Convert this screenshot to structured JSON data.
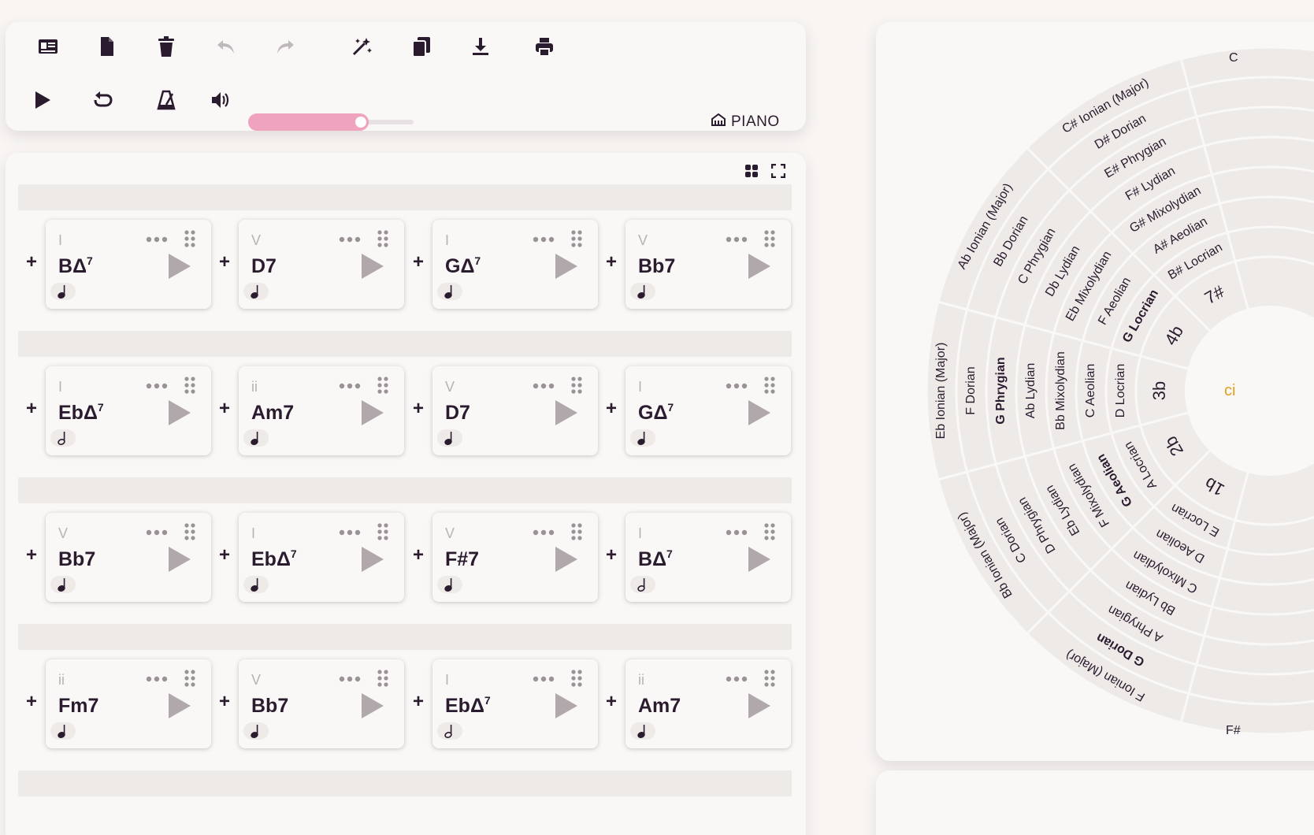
{
  "toolbar": {
    "tools_row1": [
      {
        "name": "song-info-button",
        "icon": "id-card-icon",
        "disabled": false
      },
      {
        "name": "new-file-button",
        "icon": "file-icon",
        "disabled": false
      },
      {
        "name": "delete-button",
        "icon": "trash-icon",
        "disabled": false
      },
      {
        "name": "undo-button",
        "icon": "undo-icon",
        "disabled": true
      },
      {
        "name": "redo-button",
        "icon": "redo-icon",
        "disabled": true
      },
      {
        "name": "magic-button",
        "icon": "magic-wand-icon",
        "disabled": false
      },
      {
        "name": "copy-button",
        "icon": "copy-icon",
        "disabled": false
      },
      {
        "name": "download-button",
        "icon": "download-icon",
        "disabled": false
      },
      {
        "name": "print-button",
        "icon": "print-icon",
        "disabled": false
      }
    ],
    "tools_row2": [
      {
        "name": "play-button",
        "icon": "play-icon"
      },
      {
        "name": "loop-button",
        "icon": "loop-icon"
      },
      {
        "name": "metronome-button",
        "icon": "metronome-icon"
      },
      {
        "name": "volume-button",
        "icon": "volume-icon"
      }
    ],
    "volume": 0.68,
    "instrument_label": "PIANO",
    "instrument_icon": "piano-icon",
    "accent_color": "#f0a3bf"
  },
  "panel": {
    "tools": [
      {
        "name": "grid-view-button",
        "icon": "grid-icon"
      },
      {
        "name": "fullscreen-button",
        "icon": "expand-icon"
      }
    ]
  },
  "progression": [
    [
      {
        "numeral": "I",
        "root": "B",
        "quality": "Δ",
        "ext": "7",
        "duration": "quarter"
      },
      {
        "numeral": "V",
        "root": "D7",
        "quality": "",
        "ext": "",
        "duration": "quarter"
      },
      {
        "numeral": "I",
        "root": "G",
        "quality": "Δ",
        "ext": "7",
        "duration": "quarter"
      },
      {
        "numeral": "V",
        "root": "Bb7",
        "quality": "",
        "ext": "",
        "duration": "quarter"
      }
    ],
    [
      {
        "numeral": "I",
        "root": "Eb",
        "quality": "Δ",
        "ext": "7",
        "duration": "half"
      },
      {
        "numeral": "ii",
        "root": "Am7",
        "quality": "",
        "ext": "",
        "duration": "quarter"
      },
      {
        "numeral": "V",
        "root": "D7",
        "quality": "",
        "ext": "",
        "duration": "quarter"
      },
      {
        "numeral": "I",
        "root": "G",
        "quality": "Δ",
        "ext": "7",
        "duration": "quarter"
      }
    ],
    [
      {
        "numeral": "V",
        "root": "Bb7",
        "quality": "",
        "ext": "",
        "duration": "quarter"
      },
      {
        "numeral": "I",
        "root": "Eb",
        "quality": "Δ",
        "ext": "7",
        "duration": "quarter"
      },
      {
        "numeral": "V",
        "root": "F#7",
        "quality": "",
        "ext": "",
        "duration": "quarter"
      },
      {
        "numeral": "I",
        "root": "B",
        "quality": "Δ",
        "ext": "7",
        "duration": "half"
      }
    ],
    [
      {
        "numeral": "ii",
        "root": "Fm7",
        "quality": "",
        "ext": "",
        "duration": "quarter"
      },
      {
        "numeral": "V",
        "root": "Bb7",
        "quality": "",
        "ext": "",
        "duration": "quarter"
      },
      {
        "numeral": "I",
        "root": "Eb",
        "quality": "Δ",
        "ext": "7",
        "duration": "half"
      },
      {
        "numeral": "ii",
        "root": "Am7",
        "quality": "",
        "ext": "",
        "duration": "quarter"
      }
    ]
  ],
  "wheel": {
    "center_label": "ci",
    "center_color": "#e0a020",
    "sectors": [
      {
        "key_label": "1b",
        "modes": [
          "F Ionian (Major)",
          "G Dorian",
          "A Phrygian",
          "Bb Lydian",
          "C Mixolydian",
          "D Aeolian",
          "E Locrian"
        ],
        "bold_index": 1
      },
      {
        "key_label": "2b",
        "modes": [
          "Bb Ionian (Major)",
          "C Dorian",
          "D Phrygian",
          "Eb Lydian",
          "F Mixolydian",
          "G Aeolian",
          "A Locrian"
        ],
        "bold_index": 5
      },
      {
        "key_label": "3b",
        "modes": [
          "Eb Ionian (Major)",
          "F Dorian",
          "G Phrygian",
          "Ab Lydian",
          "Bb Mixolydian",
          "C Aeolian",
          "D Locrian"
        ],
        "bold_index": 2
      },
      {
        "key_label": "4b",
        "modes": [
          "Ab Ionian (Major)",
          "Bb Dorian",
          "C Phrygian",
          "Db Lydian",
          "Eb Mixolydian",
          "F Aeolian",
          "G Locrian"
        ],
        "bold_index": 6
      },
      {
        "key_label": "7#",
        "modes": [
          "C# Ionian (Major)",
          "D# Dorian",
          "E# Phrygian",
          "F# Lydian",
          "G# Mixolydian",
          "A# Aeolian",
          "B# Locrian"
        ],
        "bold_index": -1
      }
    ],
    "partial_labels": [
      "C",
      "F#"
    ]
  }
}
